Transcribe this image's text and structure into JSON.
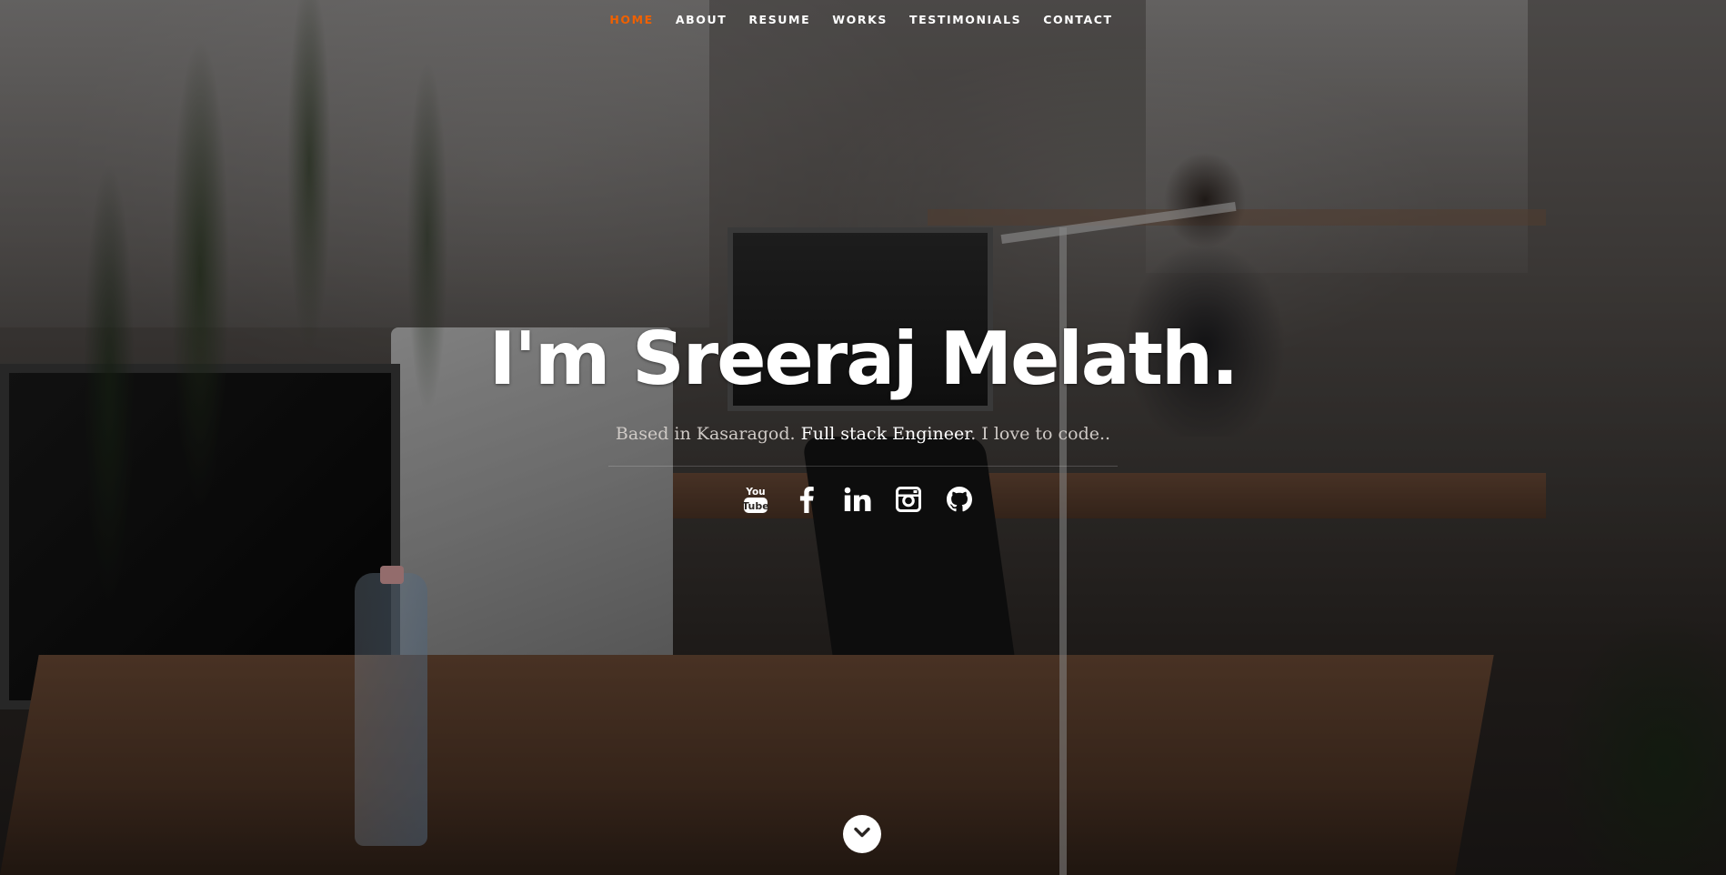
{
  "nav": {
    "items": [
      {
        "label": "HOME",
        "active": true
      },
      {
        "label": "ABOUT",
        "active": false
      },
      {
        "label": "RESUME",
        "active": false
      },
      {
        "label": "WORKS",
        "active": false
      },
      {
        "label": "TESTIMONIALS",
        "active": false
      },
      {
        "label": "CONTACT",
        "active": false
      }
    ],
    "active_color": "#f06000",
    "text_color": "#ffffff"
  },
  "banner": {
    "headline": "I'm Sreeraj Melath.",
    "subline_before": "Based in Kasaragod. ",
    "subline_highlight": "Full stack Engineer",
    "subline_after": ". I love to code.."
  },
  "social": [
    {
      "name": "youtube",
      "icon": "youtube-icon"
    },
    {
      "name": "facebook",
      "icon": "facebook-icon"
    },
    {
      "name": "linkedin",
      "icon": "linkedin-icon"
    },
    {
      "name": "instagram",
      "icon": "instagram-icon"
    },
    {
      "name": "github",
      "icon": "github-icon"
    }
  ],
  "scroll_down": {
    "icon": "chevron-down-icon"
  }
}
